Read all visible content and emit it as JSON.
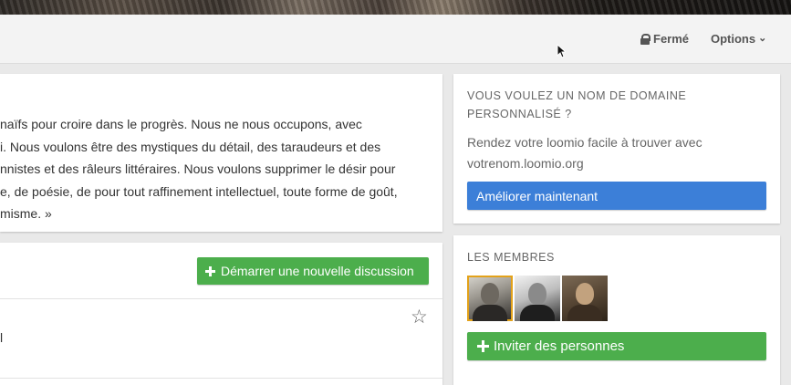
{
  "topbar": {
    "status_label": "Fermé",
    "options_label": "Options"
  },
  "group": {
    "description": "naïfs pour croire dans le progrès. Nous ne nous occupons, avec\ni. Nous voulons être des mystiques du détail, des taraudeurs et des\nnnistes et des râleurs littéraires. Nous voulons supprimer le désir pour\ne, de poésie, de pour tout raffinement intellectuel, toute forme de goût,\nmisme. »"
  },
  "discussions": {
    "new_button_label": "Démarrer une nouvelle discussion",
    "items": [
      {
        "title": "l"
      }
    ]
  },
  "domain_promo": {
    "title_line1": "VOUS VOULEZ UN NOM DE DOMAINE",
    "title_line2": "PERSONNALISÉ ?",
    "text": "Rendez votre loomio facile à trouver avec votrenom.loomio.org",
    "button_label": "Améliorer maintenant"
  },
  "members": {
    "title": "LES MEMBRES",
    "avatars": [
      {
        "icon": "member-avatar-1",
        "selected": true
      },
      {
        "icon": "member-avatar-2",
        "selected": false
      },
      {
        "icon": "member-avatar-3",
        "selected": false
      }
    ],
    "invite_label": "Inviter des personnes"
  },
  "colors": {
    "green": "#4cae4c",
    "blue": "#3c7fd8",
    "selected_outline": "#e3a21a"
  }
}
